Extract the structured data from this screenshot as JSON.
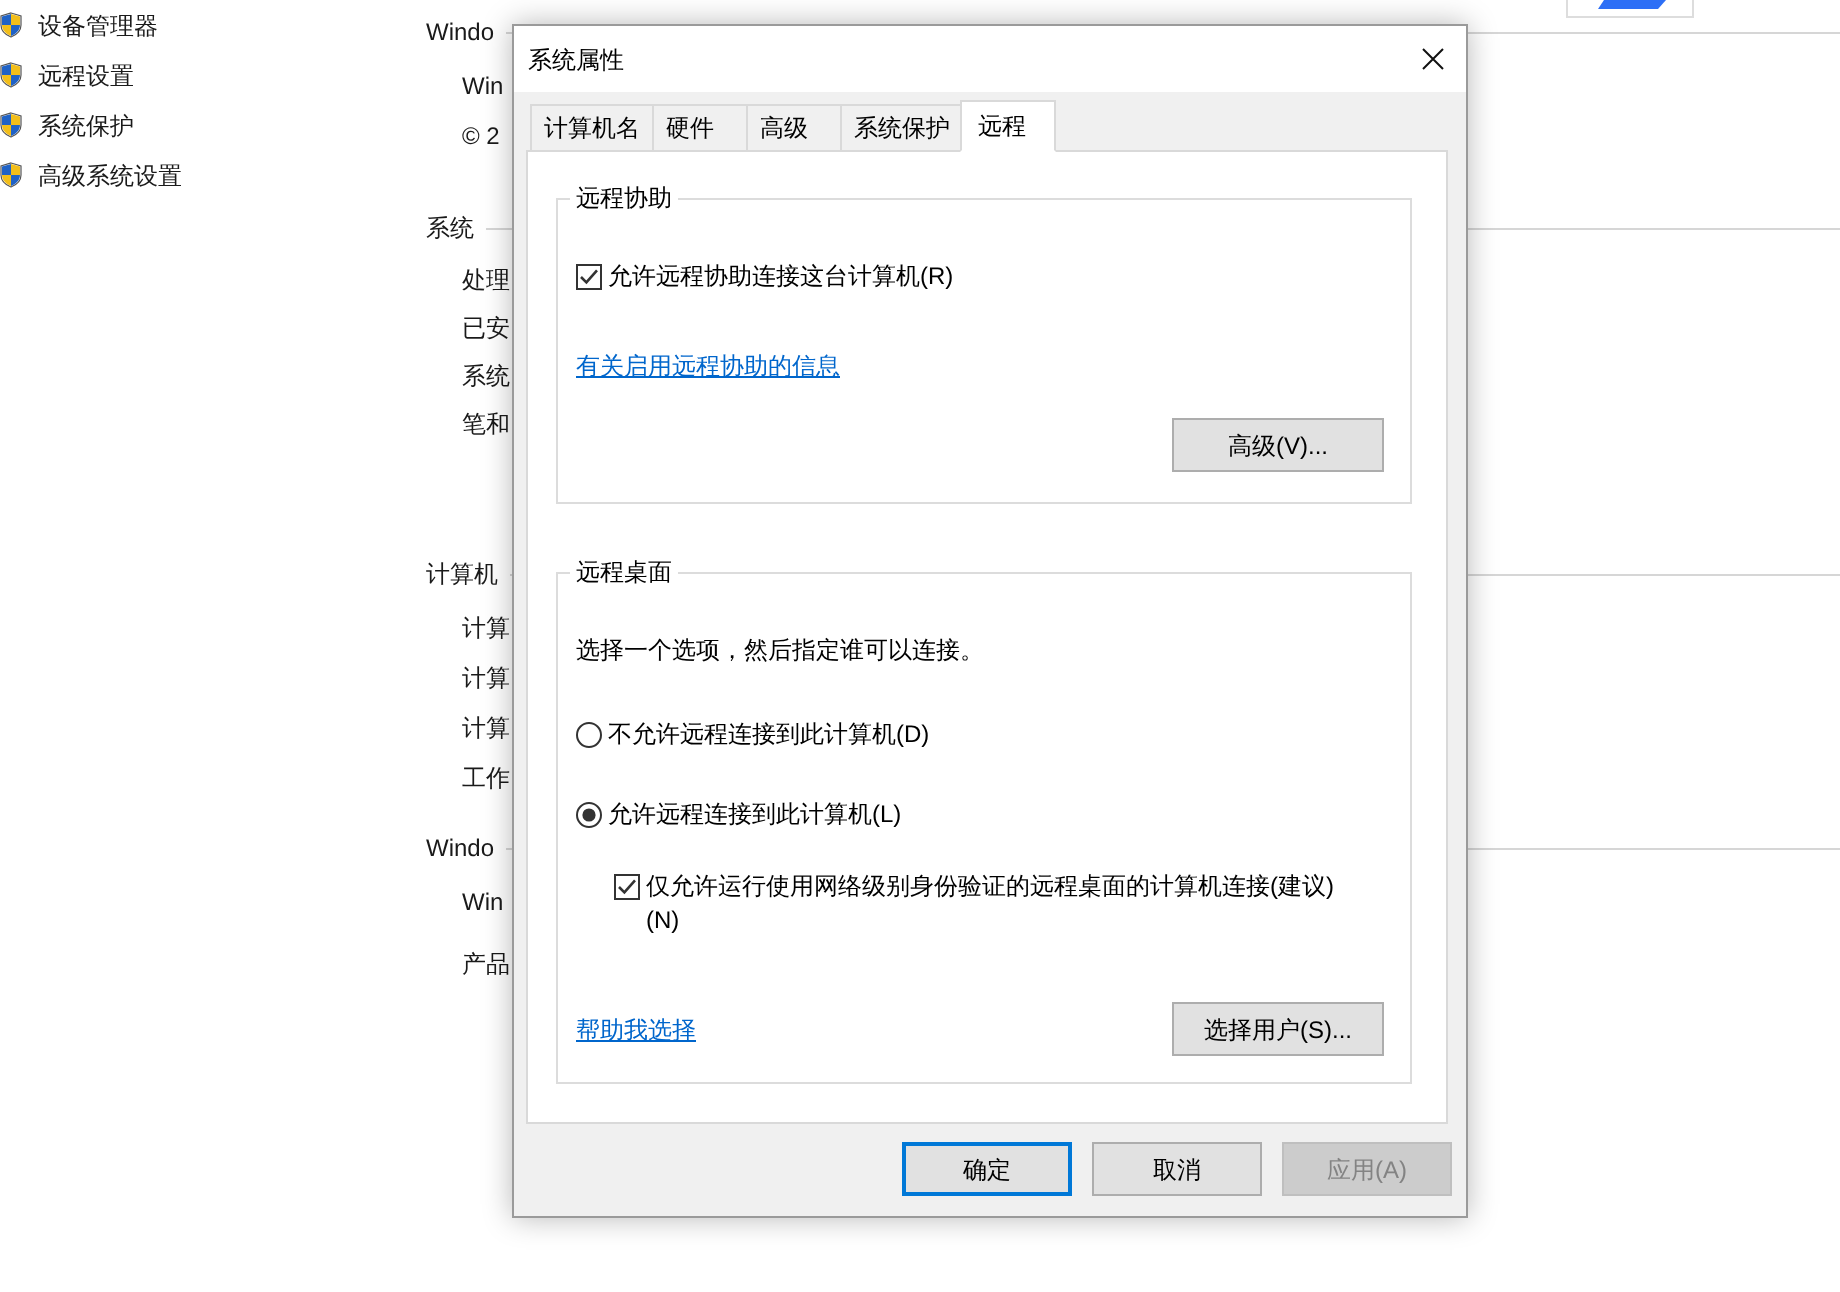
{
  "background_window": {
    "sidebar": {
      "items": [
        "设备管理器",
        "远程设置",
        "系统保护",
        "高级系统设置"
      ]
    },
    "sections": [
      {
        "title": "Windo",
        "rows": [
          "Win",
          "© 2"
        ]
      },
      {
        "title": "系统",
        "rows": [
          "处理",
          "已安",
          "系统",
          "笔和"
        ]
      },
      {
        "title": "计算机",
        "rows": [
          "计算",
          "计算",
          "计算",
          "工作"
        ]
      },
      {
        "title": "Windo",
        "rows": [
          "Win",
          "产品"
        ]
      }
    ]
  },
  "dialog": {
    "title": "系统属性",
    "tabs": [
      {
        "label": "计算机名",
        "selected": false
      },
      {
        "label": "硬件",
        "selected": false
      },
      {
        "label": "高级",
        "selected": false
      },
      {
        "label": "系统保护",
        "selected": false
      },
      {
        "label": "远程",
        "selected": true
      }
    ],
    "remote_assistance": {
      "title": "远程协助",
      "allow": {
        "label": "允许远程协助连接这台计算机(R)",
        "checked": true
      },
      "info_link": "有关启用远程协助的信息",
      "advanced_button": "高级(V)..."
    },
    "remote_desktop": {
      "title": "远程桌面",
      "instruction": "选择一个选项，然后指定谁可以连接。",
      "options": [
        {
          "label": "不允许远程连接到此计算机(D)",
          "selected": false
        },
        {
          "label": "允许远程连接到此计算机(L)",
          "selected": true
        }
      ],
      "nla_only": {
        "label": "仅允许运行使用网络级别身份验证的远程桌面的计算机连接(建议)(N)",
        "checked": true
      },
      "help_link": "帮助我选择",
      "select_users_button": "选择用户(S)..."
    },
    "buttons": [
      {
        "label": "确定",
        "default": true,
        "disabled": false
      },
      {
        "label": "取消",
        "default": false,
        "disabled": false
      },
      {
        "label": "应用(A)",
        "default": false,
        "disabled": true
      }
    ]
  }
}
